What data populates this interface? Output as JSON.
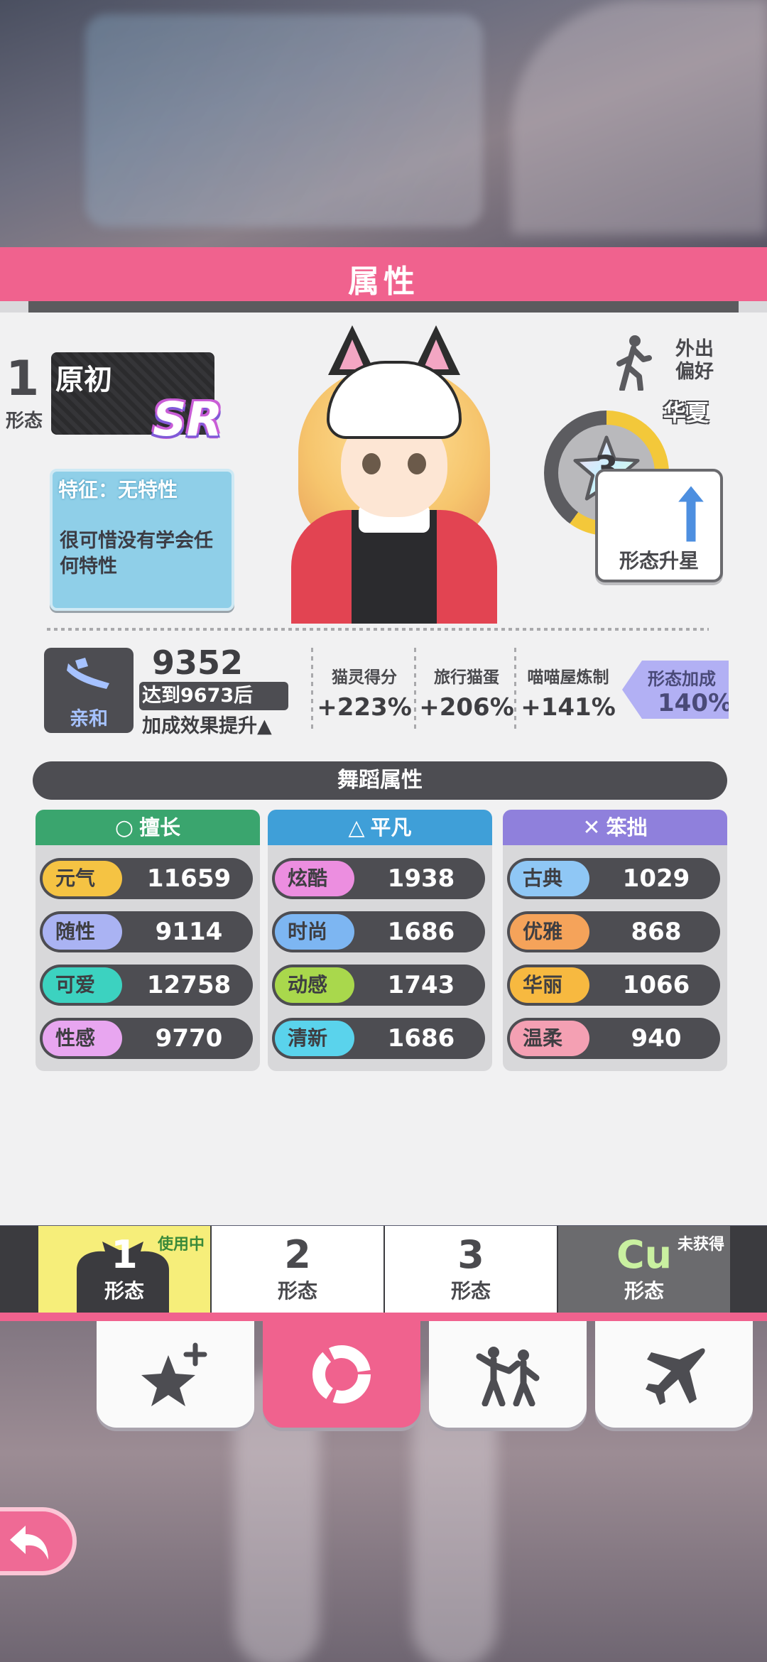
{
  "header": {
    "title": "属性"
  },
  "character": {
    "form_number": "1",
    "form_label": "形态",
    "name": "原初",
    "rarity": "SR",
    "trait_title": "特征：无特性",
    "trait_desc": "很可惜没有学会任何特性",
    "outing_label": "外出偏好",
    "outing_value": "华夏",
    "stars": "3",
    "upgrade_label": "形态升星"
  },
  "affinity": {
    "label": "亲和",
    "value": "9352",
    "goal": "达到9673后",
    "desc": "加成效果提升▲"
  },
  "bonuses": [
    {
      "label": "猫灵得分",
      "value": "+223%"
    },
    {
      "label": "旅行猫蛋",
      "value": "+206%"
    },
    {
      "label": "喵喵屋炼制",
      "value": "+141%"
    }
  ],
  "form_bonus": {
    "label": "形态加成",
    "value": "140%"
  },
  "dance": {
    "title": "舞蹈属性",
    "columns": [
      {
        "title": "擅长",
        "symbol": "○",
        "color": "#3aa56e",
        "items": [
          {
            "name": "元气",
            "value": "11659",
            "color": "#f5c343"
          },
          {
            "name": "随性",
            "value": "9114",
            "color": "#aab3f3"
          },
          {
            "name": "可爱",
            "value": "12758",
            "color": "#3cd2c0"
          },
          {
            "name": "性感",
            "value": "9770",
            "color": "#e8a6f0"
          }
        ]
      },
      {
        "title": "平凡",
        "symbol": "△",
        "color": "#3f9fd8",
        "items": [
          {
            "name": "炫酷",
            "value": "1938",
            "color": "#ec8ee0"
          },
          {
            "name": "时尚",
            "value": "1686",
            "color": "#7db6f2"
          },
          {
            "name": "动感",
            "value": "1743",
            "color": "#a9d84c"
          },
          {
            "name": "清新",
            "value": "1686",
            "color": "#5ad3ec"
          }
        ]
      },
      {
        "title": "笨拙",
        "symbol": "✕",
        "color": "#8f80dc",
        "items": [
          {
            "name": "古典",
            "value": "1029",
            "color": "#8fc7f5"
          },
          {
            "name": "优雅",
            "value": "868",
            "color": "#f5a35a"
          },
          {
            "name": "华丽",
            "value": "1066",
            "color": "#f7b940"
          },
          {
            "name": "温柔",
            "value": "940",
            "color": "#f4a0b3"
          }
        ]
      }
    ]
  },
  "tabs": [
    {
      "num": "1",
      "label": "形态",
      "badge": "使用中"
    },
    {
      "num": "2",
      "label": "形态",
      "badge": ""
    },
    {
      "num": "3",
      "label": "形态",
      "badge": ""
    },
    {
      "num": "Cu",
      "label": "形态",
      "badge": "未获得"
    }
  ],
  "nav": [
    {
      "icon": "star-plus-icon"
    },
    {
      "icon": "ring-chart-icon"
    },
    {
      "icon": "dance-icon"
    },
    {
      "icon": "airplane-icon"
    }
  ],
  "back": {
    "icon": "back-arrow-icon"
  },
  "colors": {
    "accent": "#f0628e",
    "dark": "#4d4d52",
    "panel": "#f1f1f2"
  }
}
